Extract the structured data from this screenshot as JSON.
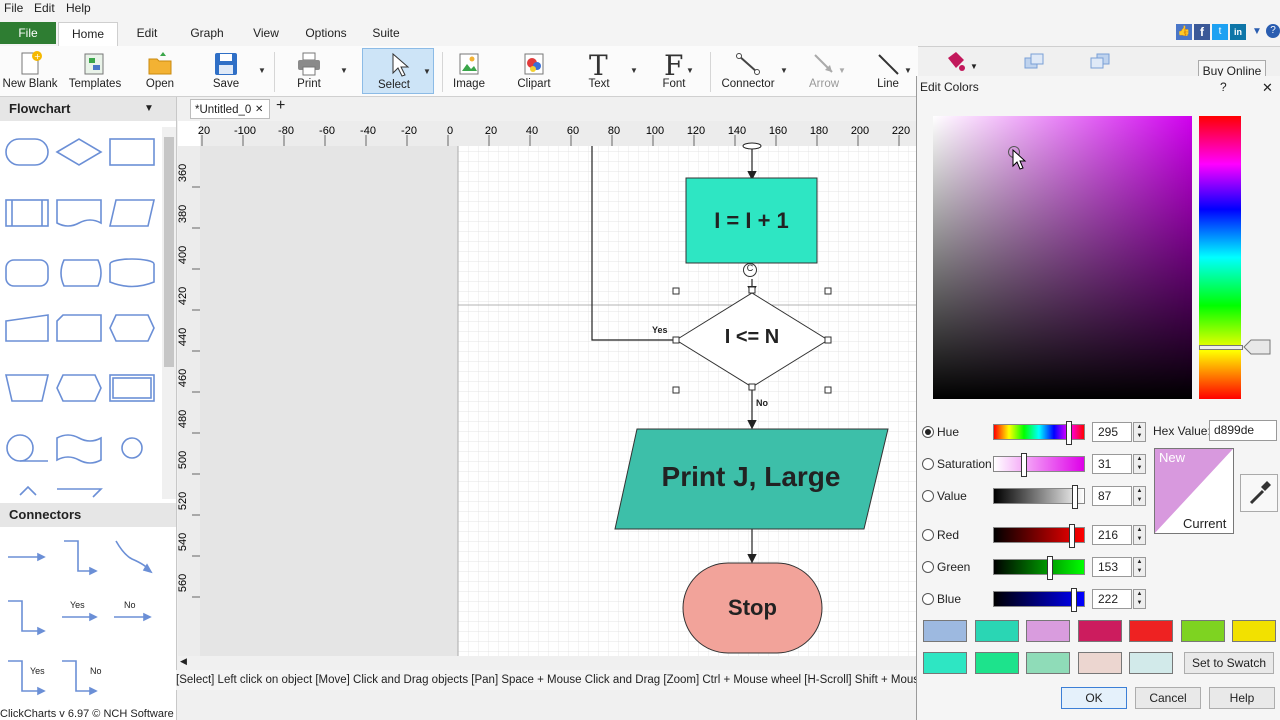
{
  "menu": {
    "file": "File",
    "edit": "Edit",
    "help": "Help"
  },
  "ribbon_tabs": [
    "File",
    "Home",
    "Edit",
    "Graph",
    "View",
    "Options",
    "Suite"
  ],
  "toolbar": {
    "new_blank": "New Blank",
    "templates": "Templates",
    "open": "Open",
    "save": "Save",
    "print": "Print",
    "select": "Select",
    "image": "Image",
    "clipart": "Clipart",
    "text": "Text",
    "font": "Font",
    "connector": "Connector",
    "arrow": "Arrow",
    "line": "Line",
    "buy_online": "Buy Online"
  },
  "sidebar": {
    "flowchart_title": "Flowchart",
    "connectors_title": "Connectors",
    "connector_labels": {
      "yes": "Yes",
      "no": "No"
    }
  },
  "document_tab": {
    "title": "*Untitled_0",
    "add": "+"
  },
  "ruler": {
    "x_ticks": [
      "20",
      "-100",
      "-80",
      "-60",
      "-40",
      "-20",
      "0",
      "20",
      "40",
      "60",
      "80",
      "100",
      "120",
      "140",
      "160",
      "180",
      "200",
      "220"
    ],
    "y_ticks": [
      "360",
      "380",
      "400",
      "420",
      "440",
      "460",
      "480",
      "500",
      "520",
      "540",
      "560"
    ]
  },
  "diagram": {
    "process_text": "I = I + 1",
    "decision_text": "I <= N",
    "io_text": "Print J, Large",
    "terminal_text": "Stop",
    "yes_label": "Yes",
    "no_label": "No",
    "connector_badge": "C",
    "colors": {
      "process": "#2ee6c3",
      "io": "#3dbfa9",
      "terminal": "#f2a39a"
    }
  },
  "status_bar": "[Select] Left click on object  [Move] Click and Drag objects  [Pan] Space + Mouse Click and Drag  [Zoom] Ctrl + Mouse wheel  [H-Scroll] Shift + Mouse wheel  [V-Scr",
  "footer": "ClickCharts v 6.97 © NCH Software",
  "dialog": {
    "title": "Edit Colors",
    "help": "?",
    "close": "✕",
    "hex_label": "Hex Value:",
    "hex_value": "d899de",
    "channels": {
      "hue": {
        "label": "Hue",
        "value": "295",
        "selected": true
      },
      "saturation": {
        "label": "Saturation",
        "value": "31"
      },
      "value": {
        "label": "Value",
        "value": "87"
      },
      "red": {
        "label": "Red",
        "value": "216"
      },
      "green": {
        "label": "Green",
        "value": "153"
      },
      "blue": {
        "label": "Blue",
        "value": "222"
      }
    },
    "preview_new": "New",
    "preview_current": "Current",
    "new_color": "#d899de",
    "current_color": "#ffffff",
    "swatches_row1": [
      "#9db9e0",
      "#2ad6b4",
      "#d99cde",
      "#cc1c5e",
      "#ee2222",
      "#7ed321",
      "#f2e100"
    ],
    "swatches_row2": [
      "#2ee6c3",
      "#1de38c",
      "#8fdcb8",
      "#ecd6d0",
      "#d2eaea"
    ],
    "set_to_swatch": "Set to Swatch",
    "ok": "OK",
    "cancel": "Cancel",
    "dialog_help": "Help"
  }
}
